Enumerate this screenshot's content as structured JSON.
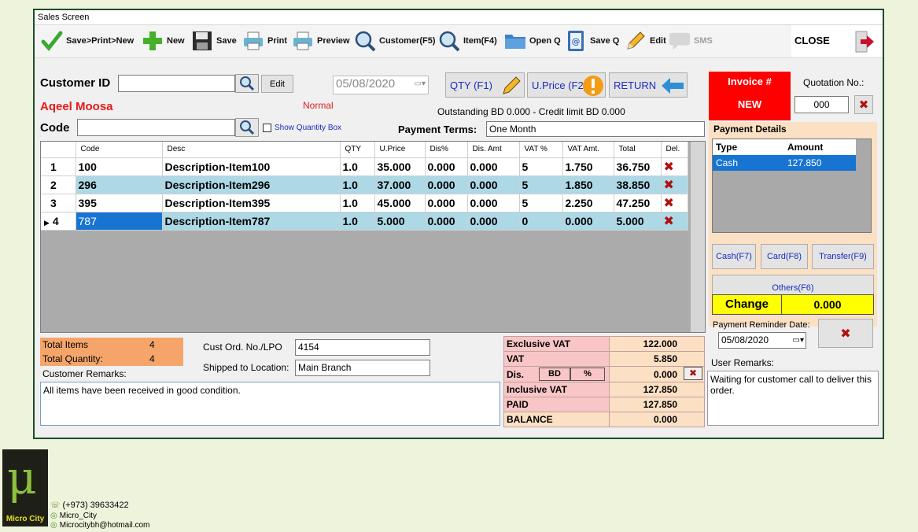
{
  "window": {
    "title": "Sales Screen"
  },
  "toolbar": {
    "save_print_new": "Save>Print>New",
    "new": "New",
    "save": "Save",
    "print": "Print",
    "preview": "Preview",
    "customer": "Customer(F5)",
    "item": "Item(F4)",
    "open_q": "Open Q",
    "save_q": "Save Q",
    "edit": "Edit",
    "sms": "SMS",
    "close": "CLOSE"
  },
  "customer": {
    "id_label": "Customer ID",
    "id_value": "",
    "edit_button": "Edit",
    "date": "05/08/2020",
    "name": "Aqeel Moosa",
    "type": "Normal",
    "code_label": "Code",
    "code_value": "",
    "show_qty_box": "Show Quantity Box",
    "outstanding": "Outstanding BD 0.000 - Credit limit BD 0.000",
    "payment_terms_label": "Payment Terms:",
    "payment_terms": "One Month"
  },
  "actions": {
    "qty": "QTY (F1)",
    "uprice": "U.Price (F2)",
    "return": "RETURN"
  },
  "grid": {
    "columns": [
      "Code",
      "Desc",
      "QTY",
      "U.Price",
      "Dis%",
      "Dis. Amt",
      "VAT %",
      "VAT Amt.",
      "Total",
      "Del."
    ],
    "rows": [
      {
        "num": "1",
        "code": "100",
        "desc": "Description-Item100",
        "qty": "1.0",
        "uprice": "35.000",
        "dis_pct": "0.000",
        "dis_amt": "0.000",
        "vat_pct": "5",
        "vat_amt": "1.750",
        "total": "36.750"
      },
      {
        "num": "2",
        "code": "296",
        "desc": "Description-Item296",
        "qty": "1.0",
        "uprice": "37.000",
        "dis_pct": "0.000",
        "dis_amt": "0.000",
        "vat_pct": "5",
        "vat_amt": "1.850",
        "total": "38.850"
      },
      {
        "num": "3",
        "code": "395",
        "desc": "Description-Item395",
        "qty": "1.0",
        "uprice": "45.000",
        "dis_pct": "0.000",
        "dis_amt": "0.000",
        "vat_pct": "5",
        "vat_amt": "2.250",
        "total": "47.250"
      },
      {
        "num": "4",
        "code": "787",
        "desc": "Description-Item787",
        "qty": "1.0",
        "uprice": "5.000",
        "dis_pct": "0.000",
        "dis_amt": "0.000",
        "vat_pct": "0",
        "vat_amt": "0.000",
        "total": "5.000"
      }
    ]
  },
  "invoice": {
    "label": "Invoice #",
    "value": "NEW",
    "quotation_label": "Quotation No.:",
    "quotation_value": "000"
  },
  "payment": {
    "title": "Payment Details",
    "col_type": "Type",
    "col_amount": "Amount",
    "rows": [
      {
        "type": "Cash",
        "amount": "127.850"
      }
    ],
    "cash_btn": "Cash(F7)",
    "card_btn": "Card(F8)",
    "transfer_btn": "Transfer(F9)",
    "others_btn": "Others(F6)",
    "change_label": "Change",
    "change_value": "0.000",
    "reminder_label": "Payment Reminder Date:",
    "reminder_date": "05/08/2020"
  },
  "totals": {
    "items_label": "Total Items",
    "items_value": "4",
    "qty_label": "Total Quantity:",
    "qty_value": "4"
  },
  "order": {
    "lpo_label": "Cust Ord. No./LPO",
    "lpo_value": "4154",
    "ship_label": "Shipped to Location:",
    "ship_value": "Main Branch"
  },
  "summary": {
    "excl_vat_label": "Exclusive VAT",
    "excl_vat": "122.000",
    "vat_label": "VAT",
    "vat": "5.850",
    "dis_label": "Dis.",
    "dis_bd": "BD",
    "dis_pct": "%",
    "dis": "0.000",
    "incl_vat_label": "Inclusive VAT",
    "incl_vat": "127.850",
    "paid_label": "PAID",
    "paid": "127.850",
    "balance_label": "BALANCE",
    "balance": "0.000"
  },
  "remarks": {
    "customer_label": "Customer Remarks:",
    "customer_text": "All items have been received in good condition.",
    "user_label": "User Remarks:",
    "user_text": "Waiting for customer call to deliver this order."
  },
  "branding": {
    "logo_symbol": "μ",
    "logo_text": "Micro City",
    "phone": "(+973) 39633422",
    "instagram": "Micro_City",
    "email": "Microcitybh@hotmail.com"
  }
}
